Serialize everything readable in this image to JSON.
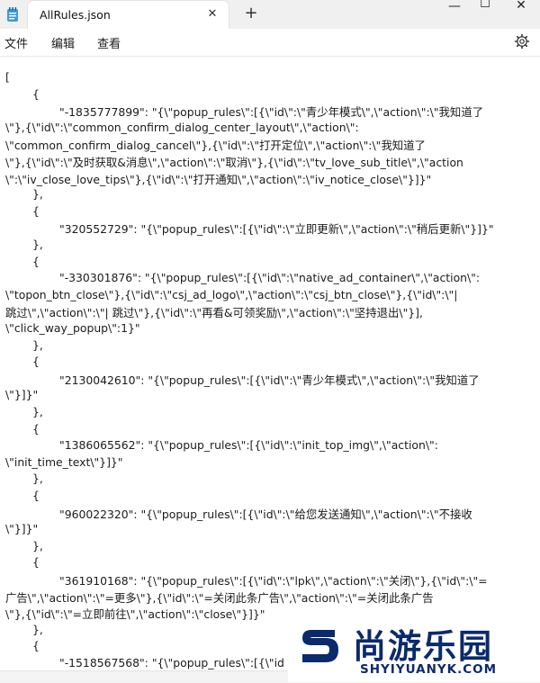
{
  "window": {
    "tab_title": "AllRules.json",
    "tab_close_glyph": "✕",
    "new_tab_glyph": "+",
    "minimize_glyph": "—",
    "maximize_glyph": "☐",
    "close_glyph": "✕"
  },
  "menu": {
    "file": "文件",
    "edit": "编辑",
    "view": "查看",
    "settings_icon": "gear-icon"
  },
  "editor": {
    "lines": [
      "[",
      "\t{",
      "\t\t\"-1835777899\": \"{\\\"popup_rules\\\":[{\\\"id\\\":\\\"青少年模式\\\",\\\"action\\\":\\\"我知道了",
      "\\\"},{\\\"id\\\":\\\"common_confirm_dialog_center_layout\\\",\\\"action\\\":",
      "\\\"common_confirm_dialog_cancel\\\"},{\\\"id\\\":\\\"打开定位\\\",\\\"action\\\":\\\"我知道了",
      "\\\"},{\\\"id\\\":\\\"及时获取&消息\\\",\\\"action\\\":\\\"取消\\\"},{\\\"id\\\":\\\"tv_love_sub_title\\\",\\\"action",
      "\\\":\\\"iv_close_love_tips\\\"},{\\\"id\\\":\\\"打开通知\\\",\\\"action\\\":\\\"iv_notice_close\\\"}]}\"",
      "\t},",
      "\t{",
      "\t\t\"320552729\": \"{\\\"popup_rules\\\":[{\\\"id\\\":\\\"立即更新\\\",\\\"action\\\":\\\"稍后更新\\\"}]}\"",
      "\t},",
      "\t{",
      "\t\t\"-330301876\": \"{\\\"popup_rules\\\":[{\\\"id\\\":\\\"native_ad_container\\\",\\\"action\\\":",
      "\\\"topon_btn_close\\\"},{\\\"id\\\":\\\"csj_ad_logo\\\",\\\"action\\\":\\\"csj_btn_close\\\"},{\\\"id\\\":\\\"|",
      "跳过\\\",\\\"action\\\":\\\"| 跳过\\\"},{\\\"id\\\":\\\"再看&可领奖励\\\",\\\"action\\\":\\\"坚持退出\\\"}],",
      "\\\"click_way_popup\\\":1}\"",
      "\t},",
      "\t{",
      "\t\t\"2130042610\": \"{\\\"popup_rules\\\":[{\\\"id\\\":\\\"青少年模式\\\",\\\"action\\\":\\\"我知道了",
      "\\\"}]}\"",
      "\t},",
      "\t{",
      "\t\t\"1386065562\": \"{\\\"popup_rules\\\":[{\\\"id\\\":\\\"init_top_img\\\",\\\"action\\\":",
      "\\\"init_time_text\\\"}]}\"",
      "\t},",
      "\t{",
      "\t\t\"960022320\": \"{\\\"popup_rules\\\":[{\\\"id\\\":\\\"给您发送通知\\\",\\\"action\\\":\\\"不接收",
      "\\\"}]}\"",
      "\t},",
      "\t{",
      "\t\t\"361910168\": \"{\\\"popup_rules\\\":[{\\\"id\\\":\\\"lpk\\\",\\\"action\\\":\\\"关闭\\\"},{\\\"id\\\":\\\"=",
      "广告\\\",\\\"action\\\":\\\"=更多\\\"},{\\\"id\\\":\\\"=关闭此条广告\\\",\\\"action\\\":\\\"=关闭此条广告",
      "\\\"},{\\\"id\\\":\\\"=立即前往\\\",\\\"action\\\":\\\"close\\\"}]}\"",
      "\t},",
      "\t{",
      "\t\t\"-1518567568\": \"{\\\"popup_rules\\\":[{\\\"id"
    ]
  },
  "watermark": {
    "cn": "尚游乐园",
    "en": "SHYIYUANYK.COM"
  }
}
